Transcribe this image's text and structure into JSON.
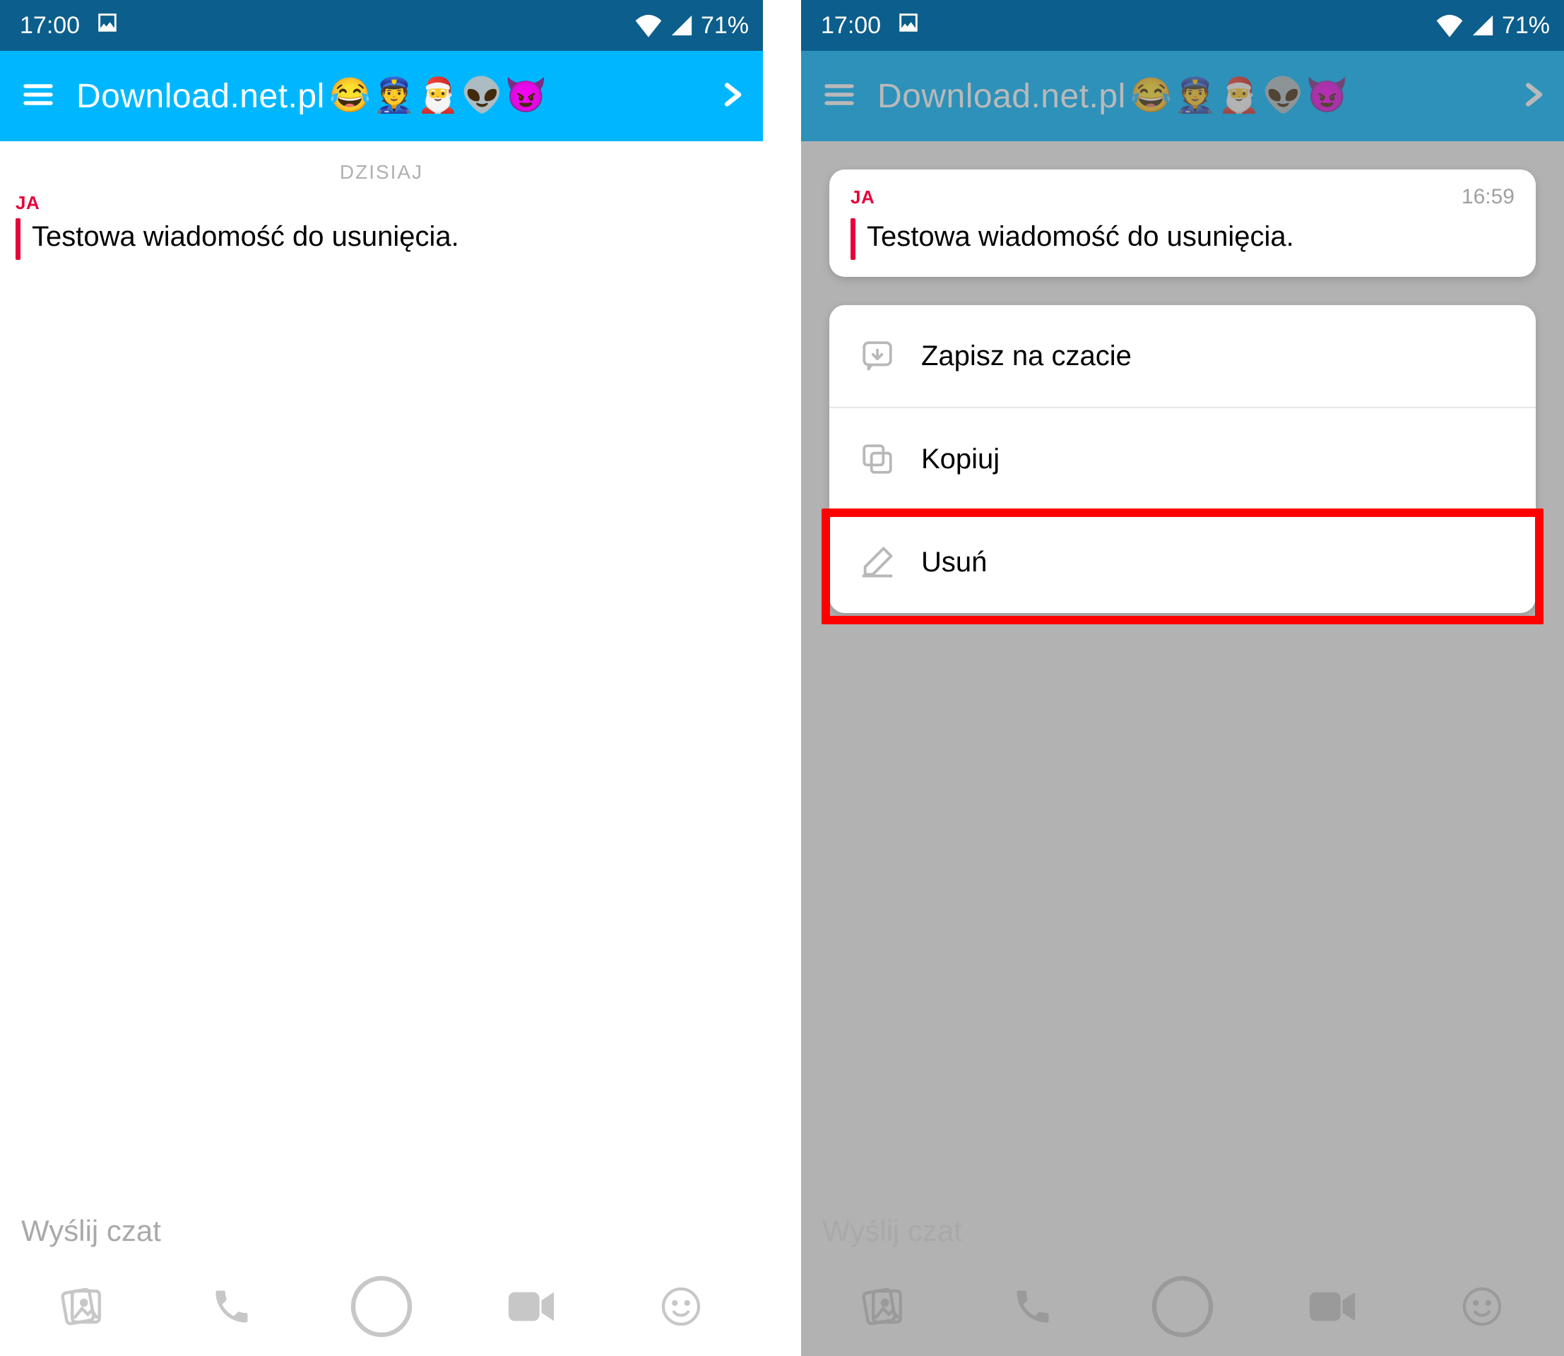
{
  "status": {
    "time": "17:00",
    "battery": "71%"
  },
  "header": {
    "title": "Download.net.pl",
    "emoji": [
      "😂",
      "👮",
      "🎅",
      "👽",
      "😈"
    ]
  },
  "chat": {
    "date_divider": "DZISIAJ",
    "sender": "JA",
    "message": "Testowa wiadomość do usunięcia.",
    "timestamp": "16:59"
  },
  "composer": {
    "placeholder": "Wyślij czat"
  },
  "context_menu": {
    "save": "Zapisz na czacie",
    "copy": "Kopiuj",
    "delete": "Usuń"
  }
}
